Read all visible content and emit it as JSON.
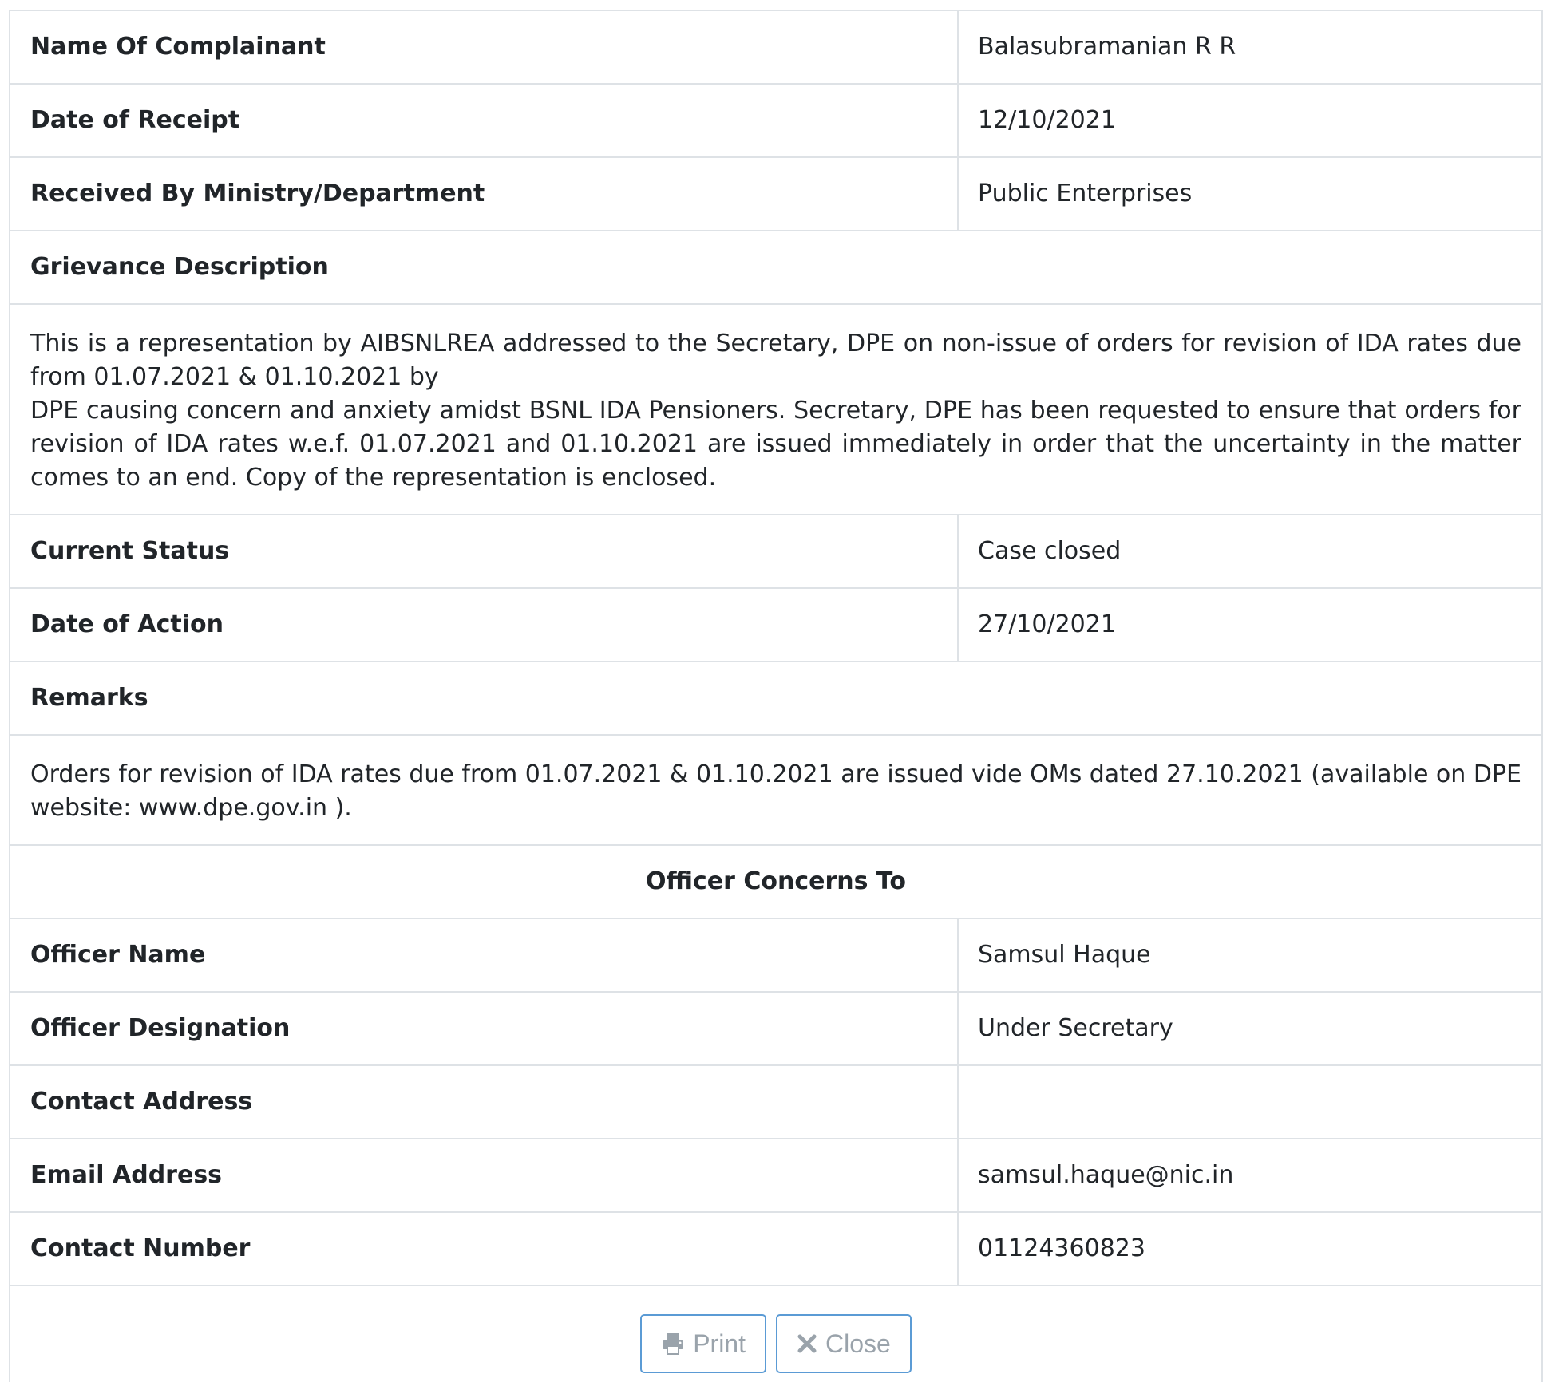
{
  "details": {
    "complainant_label": "Name Of Complainant",
    "complainant_value": "Balasubramanian R R",
    "receipt_label": "Date of Receipt",
    "receipt_value": "12/10/2021",
    "ministry_label": "Received By Ministry/Department",
    "ministry_value": "Public Enterprises",
    "description_label": "Grievance Description",
    "description_line1": "This is a representation by AIBSNLREA addressed to the Secretary, DPE on non-issue of orders for revision of IDA rates due from 01.07.2021 & 01.10.2021 by",
    "description_line2": "DPE causing concern and anxiety amidst BSNL IDA Pensioners. Secretary, DPE has been requested to ensure that orders for revision of IDA rates w.e.f. 01.07.2021 and 01.10.2021 are issued immediately in order that the uncertainty in the matter comes to an end. Copy of the representation is enclosed.",
    "status_label": "Current Status",
    "status_value": "Case closed",
    "action_label": "Date of Action",
    "action_value": "27/10/2021",
    "remarks_label": "Remarks",
    "remarks_value": "Orders for revision of IDA rates due from 01.07.2021 & 01.10.2021 are issued vide OMs dated 27.10.2021 (available on DPE website: www.dpe.gov.in )."
  },
  "officer": {
    "heading": "Officer Concerns To",
    "name_label": "Officer Name",
    "name_value": "Samsul Haque",
    "designation_label": "Officer Designation",
    "designation_value": "Under Secretary",
    "address_label": "Contact Address",
    "address_value": "",
    "email_label": "Email Address",
    "email_value": "samsul.haque@nic.in",
    "phone_label": "Contact Number",
    "phone_value": "01124360823"
  },
  "actions": {
    "print_label": "Print",
    "print_icon": "printer-icon",
    "close_label": "Close",
    "close_icon": "close-icon"
  },
  "colors": {
    "border": "#dee2e6",
    "button_border": "#5b9bd5",
    "button_text": "#9aa3ab"
  }
}
